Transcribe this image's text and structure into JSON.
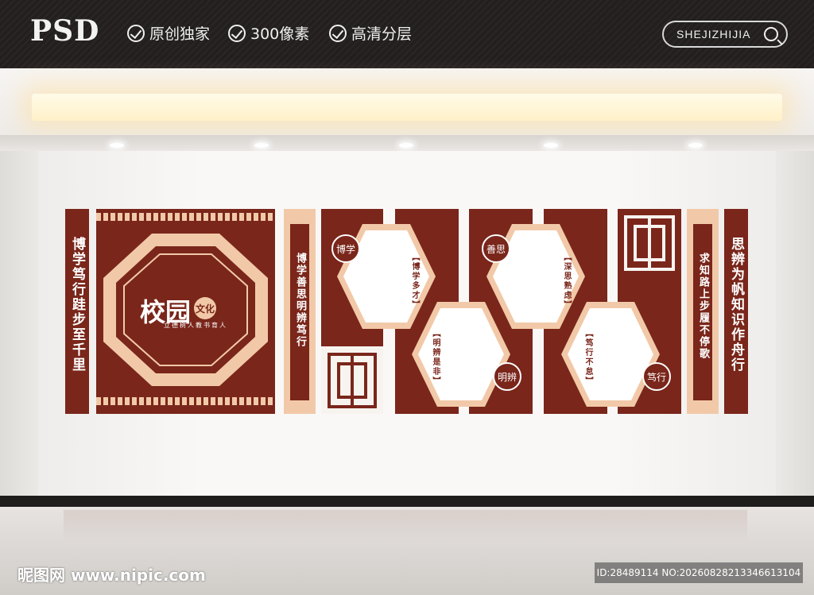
{
  "header": {
    "logo": "PSD",
    "features": [
      "原创独家",
      "300像素",
      "高清分层"
    ],
    "search_text": "SHEJIZHIJIA"
  },
  "panel": {
    "left_column": "博学笃行跬步至千里",
    "center_title": "校园",
    "center_badge": "文化",
    "center_subtitle": "立德树人教书育人",
    "inner_column": "博学善思明辨笃行",
    "right_inner_column": "求知路上步履不停歌",
    "right_column": "思辨为帆知识作舟行"
  },
  "hexagons": [
    {
      "label": "博学",
      "heading": "【博学多才】"
    },
    {
      "label": "明辨",
      "heading": "【明辨是非】"
    },
    {
      "label": "善思",
      "heading": "【深思熟虑】"
    },
    {
      "label": "笃行",
      "heading": "【笃行不怠】"
    }
  ],
  "watermark": {
    "left": "昵图网 www.nipic.com",
    "right": "ID:28489114 NO:20260828213346613104"
  },
  "colors": {
    "maroon": "#7a261b",
    "peach": "#f2c9a8"
  }
}
